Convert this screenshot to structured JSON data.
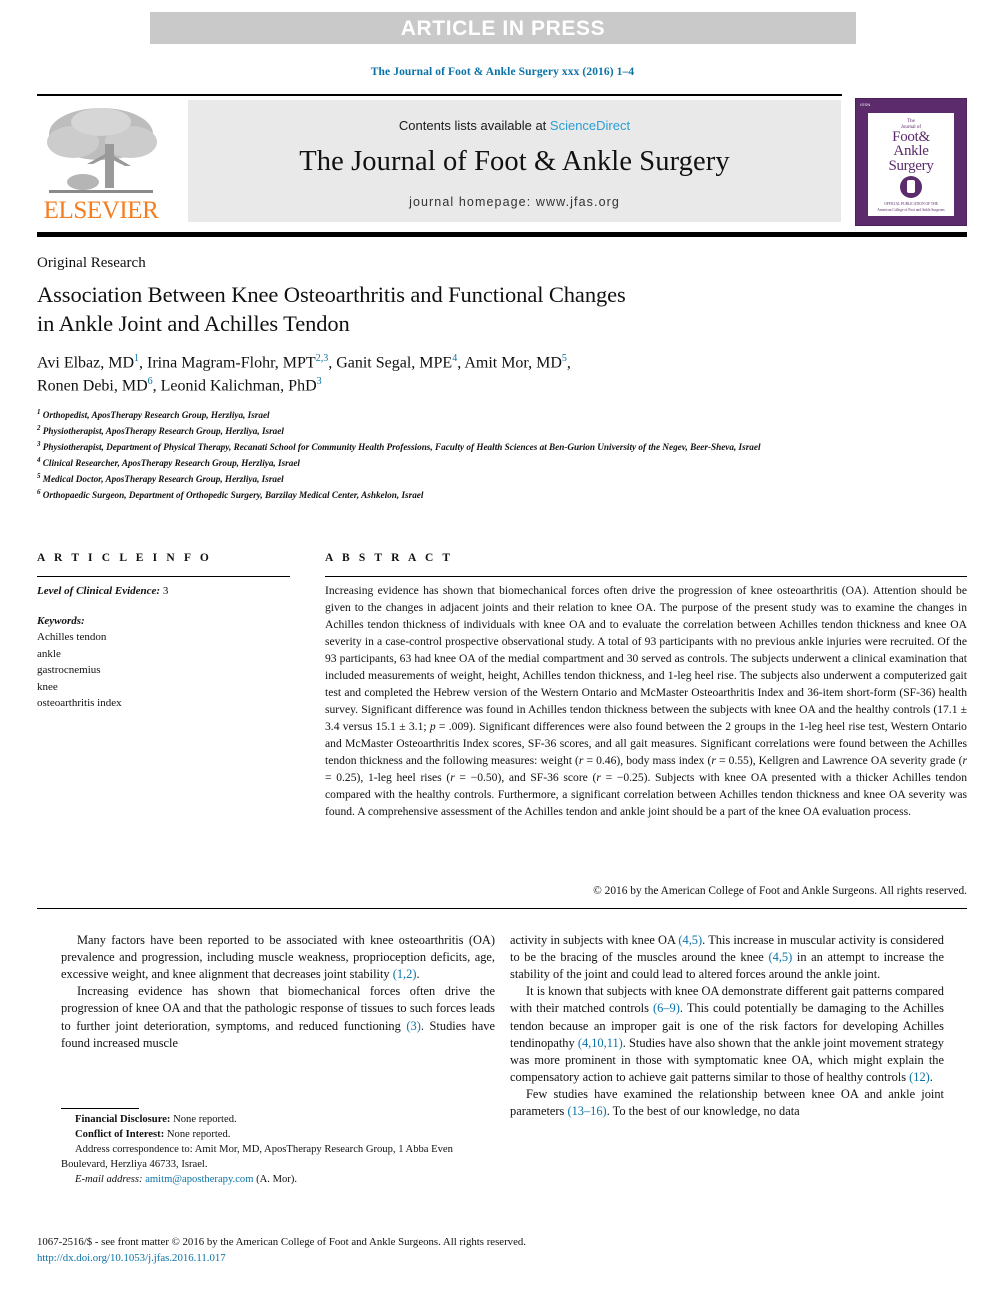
{
  "banner": {
    "text": "ARTICLE IN PRESS"
  },
  "citation_line": "The Journal of Foot & Ankle Surgery xxx (2016) 1–4",
  "masthead": {
    "publisher": "ELSEVIER",
    "contents_prefix": "Contents lists available at ",
    "contents_link": "ScienceDirect",
    "journal_name": "The Journal of Foot & Ankle Surgery",
    "homepage": "journal homepage: www.jfas.org",
    "cover": {
      "tag": "ISSN",
      "line1": "The",
      "line2": "Journal of",
      "title1": "Foot&",
      "title2": "Ankle",
      "title3": "Surgery",
      "footer1": "OFFICIAL PUBLICATION OF THE",
      "footer2": "American College of Foot and Ankle Surgeons"
    }
  },
  "article": {
    "kicker": "Original Research",
    "title_line1": "Association Between Knee Osteoarthritis and Functional Changes",
    "title_line2": "in Ankle Joint and Achilles Tendon",
    "authors": [
      {
        "name": "Avi Elbaz, MD",
        "sup": "1"
      },
      {
        "name": "Irina Magram-Flohr, MPT",
        "sup": "2,3"
      },
      {
        "name": "Ganit Segal, MPE",
        "sup": "4"
      },
      {
        "name": "Amit Mor, MD",
        "sup": "5"
      },
      {
        "name": "Ronen Debi, MD",
        "sup": "6"
      },
      {
        "name": "Leonid Kalichman, PhD",
        "sup": "3"
      }
    ],
    "affiliations": [
      {
        "sup": "1",
        "text": "Orthopedist, AposTherapy Research Group, Herzliya, Israel"
      },
      {
        "sup": "2",
        "text": "Physiotherapist, AposTherapy Research Group, Herzliya, Israel"
      },
      {
        "sup": "3",
        "text": "Physiotherapist, Department of Physical Therapy, Recanati School for Community Health Professions, Faculty of Health Sciences at Ben-Gurion University of the Negev, Beer-Sheva, Israel"
      },
      {
        "sup": "4",
        "text": "Clinical Researcher, AposTherapy Research Group, Herzliya, Israel"
      },
      {
        "sup": "5",
        "text": "Medical Doctor, AposTherapy Research Group, Herzliya, Israel"
      },
      {
        "sup": "6",
        "text": "Orthopaedic Surgeon, Department of Orthopedic Surgery, Barzilay Medical Center, Ashkelon, Israel"
      }
    ]
  },
  "article_info": {
    "heading": "A R T I C L E   I N F O",
    "evidence_label": "Level of Clinical Evidence:",
    "evidence_value": "3",
    "keywords_label": "Keywords:",
    "keywords": [
      "Achilles tendon",
      "ankle",
      "gastrocnemius",
      "knee",
      "osteoarthritis index"
    ]
  },
  "abstract": {
    "heading": "A B S T R A C T",
    "part1": "Increasing evidence has shown that biomechanical forces often drive the progression of knee osteoarthritis (OA). Attention should be given to the changes in adjacent joints and their relation to knee OA. The purpose of the present study was to examine the changes in Achilles tendon thickness of individuals with knee OA and to evaluate the correlation between Achilles tendon thickness and knee OA severity in a case-control prospective observational study. A total of 93 participants with no previous ankle injuries were recruited. Of the 93 participants, 63 had knee OA of the medial compartment and 30 served as controls. The subjects underwent a clinical examination that included measurements of weight, height, Achilles tendon thickness, and 1-leg heel rise. The subjects also underwent a computerized gait test and completed the Hebrew version of the Western Ontario and McMaster Osteoarthritis Index and 36-item short-form (SF-36) health survey. Significant difference was found in Achilles tendon thickness between the subjects with knee OA and the healthy controls (17.1 ± 3.4 versus 15.1 ± 3.1; ",
    "stat_italic1": "p",
    "part2": " = .009). Significant differences were also found between the 2 groups in the 1-leg heel rise test, Western Ontario and McMaster Osteoarthritis Index scores, SF-36 scores, and all gait measures. Significant correlations were found between the Achilles tendon thickness and the following measures: weight (",
    "r1": "r",
    "part3": " = 0.46), body mass index (",
    "r2": "r",
    "part4": " = 0.55), Kellgren and Lawrence OA severity grade (",
    "r3": "r",
    "part5": " = 0.25), 1-leg heel rises (",
    "r4": "r",
    "part6": " = −0.50), and SF-36 score (",
    "r5": "r",
    "part7": " = −0.25). Subjects with knee OA presented with a thicker Achilles tendon compared with the healthy controls. Furthermore, a significant correlation between Achilles tendon thickness and knee OA severity was found. A comprehensive assessment of the Achilles tendon and ankle joint should be a part of the knee OA evaluation process.",
    "copyright": "© 2016 by the American College of Foot and Ankle Surgeons. All rights reserved."
  },
  "body": {
    "left": {
      "p1_a": "Many factors have been reported to be associated with knee osteoarthritis (OA) prevalence and progression, including muscle weakness, proprioception deficits, age, excessive weight, and knee alignment that decreases joint stability ",
      "p1_ref": "(1,2)",
      "p1_b": ".",
      "p2_a": "Increasing evidence has shown that biomechanical forces often drive the progression of knee OA and that the pathologic response of tissues to such forces leads to further joint deterioration, symptoms, and reduced functioning ",
      "p2_ref": "(3)",
      "p2_b": ". Studies have found increased muscle"
    },
    "right": {
      "p1_a": "activity in subjects with knee OA ",
      "p1_ref1": "(4,5)",
      "p1_b": ". This increase in muscular activity is considered to be the bracing of the muscles around the knee ",
      "p1_ref2": "(4,5)",
      "p1_c": " in an attempt to increase the stability of the joint and could lead to altered forces around the ankle joint.",
      "p2_a": "It is known that subjects with knee OA demonstrate different gait patterns compared with their matched controls ",
      "p2_ref1": "(6–9)",
      "p2_b": ". This could potentially be damaging to the Achilles tendon because an improper gait is one of the risk factors for developing Achilles tendinopathy ",
      "p2_ref2": "(4,10,11)",
      "p2_c": ". Studies have also shown that the ankle joint movement strategy was more prominent in those with symptomatic knee OA, which might explain the compensatory action to achieve gait patterns similar to those of healthy controls ",
      "p2_ref3": "(12)",
      "p2_d": ".",
      "p3_a": "Few studies have examined the relationship between knee OA and ankle joint parameters ",
      "p3_ref": "(13–16)",
      "p3_b": ". To the best of our knowledge, no data"
    }
  },
  "footnotes": {
    "financial_label": "Financial Disclosure:",
    "financial_value": " None reported.",
    "conflict_label": "Conflict of Interest:",
    "conflict_value": " None reported.",
    "address": "Address correspondence to: Amit Mor, MD, AposTherapy Research Group, 1 Abba Even Boulevard, Herzliya 46733, Israel.",
    "email_label": "E-mail address:",
    "email": "amitm@apostherapy.com",
    "email_suffix": " (A. Mor)."
  },
  "bottom": {
    "front_matter": "1067-2516/$ - see front matter © 2016 by the American College of Foot and Ankle Surgeons. All rights reserved.",
    "doi": "http://dx.doi.org/10.1053/j.jfas.2016.11.017"
  },
  "colors": {
    "link": "#0b72a6",
    "sciencedirect": "#2a9fd6",
    "elsevier_orange": "#f47d20",
    "banner_bg": "#c9c9c9",
    "masthead_bg": "#e9e9e9",
    "cover_purple": "#5b2b6b"
  }
}
